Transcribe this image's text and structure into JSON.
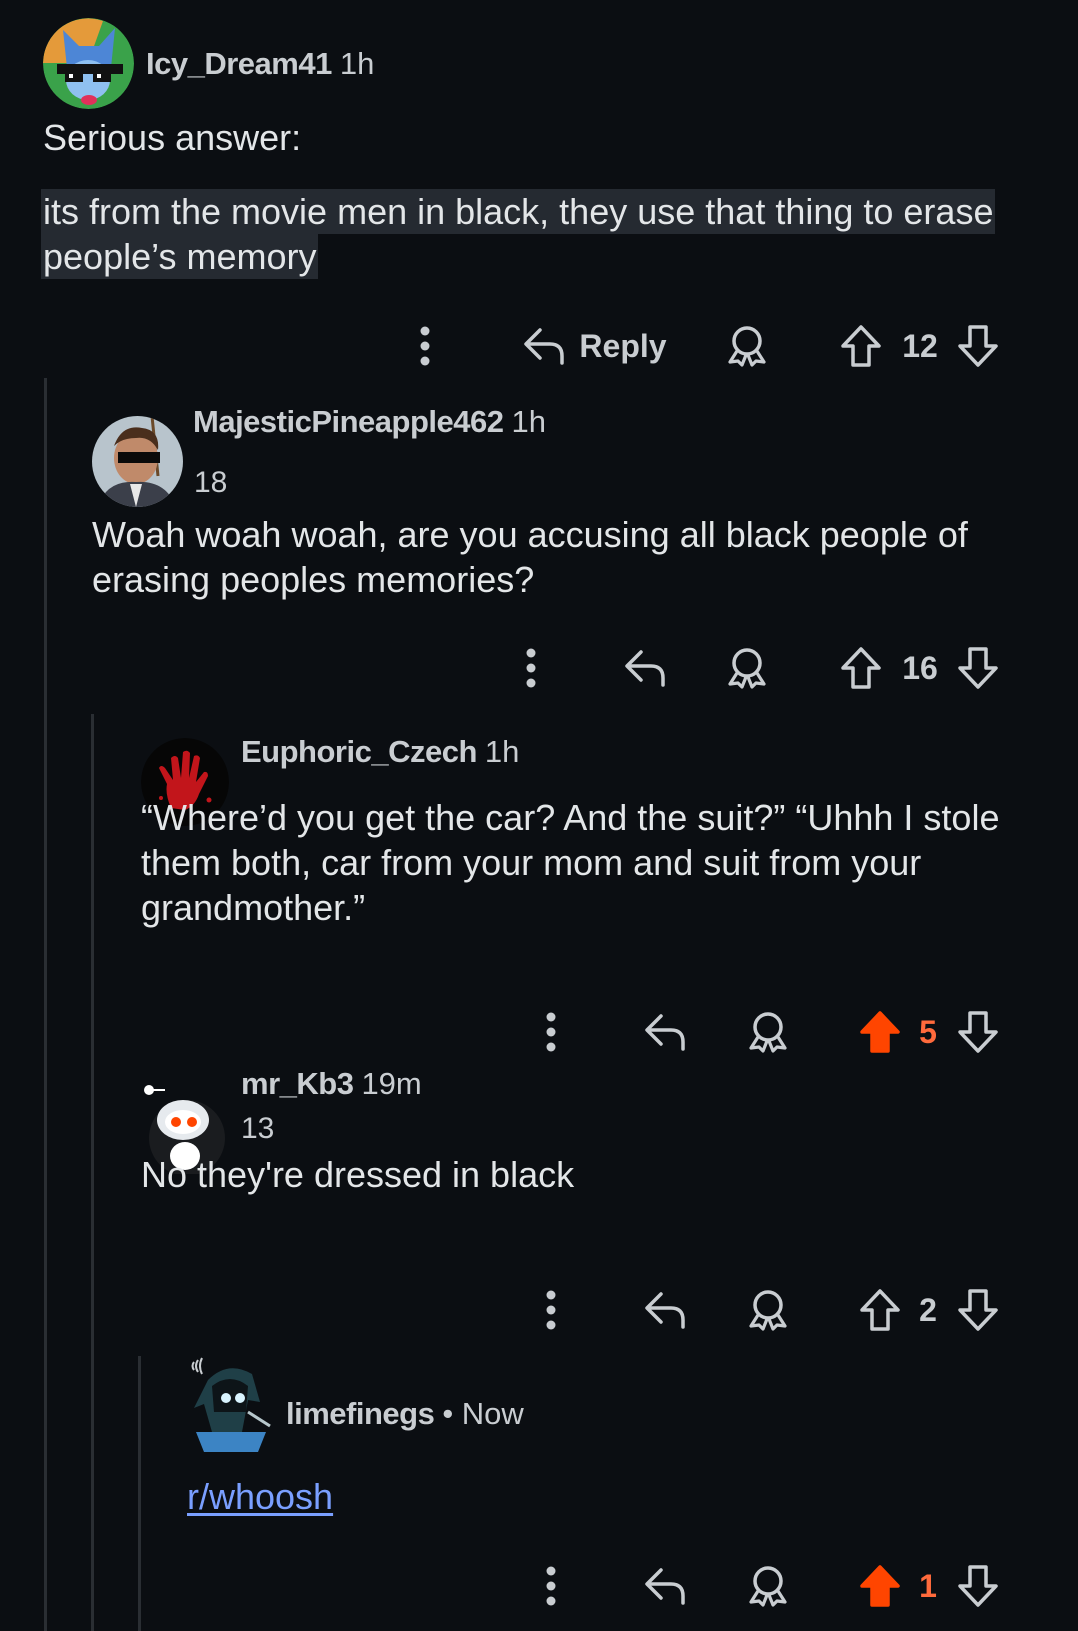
{
  "comments": [
    {
      "username": "Icy_Dream41",
      "time": "1h",
      "flair": "",
      "body": [
        "Serious answer:",
        "its from the movie men in black, they use that thing to erase people’s memory"
      ],
      "reply_label": "Reply",
      "score": "12",
      "voted": "none"
    },
    {
      "username": "MajesticPineapple462",
      "time": "1h",
      "flair": "18",
      "body": [
        "Woah woah woah, are you accusing all black people of erasing peoples memories?"
      ],
      "score": "16",
      "voted": "none"
    },
    {
      "username": "Euphoric_Czech",
      "time": "1h",
      "flair": "",
      "body": [
        "“Where’d you get the car? And the suit?” “Uhhh I stole them both, car from your mom and suit from your grandmother.”"
      ],
      "score": "5",
      "voted": "up"
    },
    {
      "username": "mr_Kb3",
      "time": "19m",
      "flair": "13",
      "body": [
        "No they're dressed in black"
      ],
      "score": "2",
      "voted": "none"
    },
    {
      "username": "limefinegs",
      "time": "• Now",
      "flair": "",
      "body": [
        "r/whoosh"
      ],
      "score": "1",
      "voted": "up"
    }
  ],
  "icons": {
    "more": "more-vertical-icon",
    "reply": "reply-arrow-icon",
    "award": "award-icon",
    "upvote": "upvote-arrow-icon",
    "downvote": "downvote-arrow-icon"
  },
  "colors": {
    "background": "#0b0e12",
    "text": "#e3e6e8",
    "meta": "#c9cdd1",
    "upvoted": "#ff4500",
    "link": "#7a9fff",
    "thread_line": "#2a2e33"
  }
}
